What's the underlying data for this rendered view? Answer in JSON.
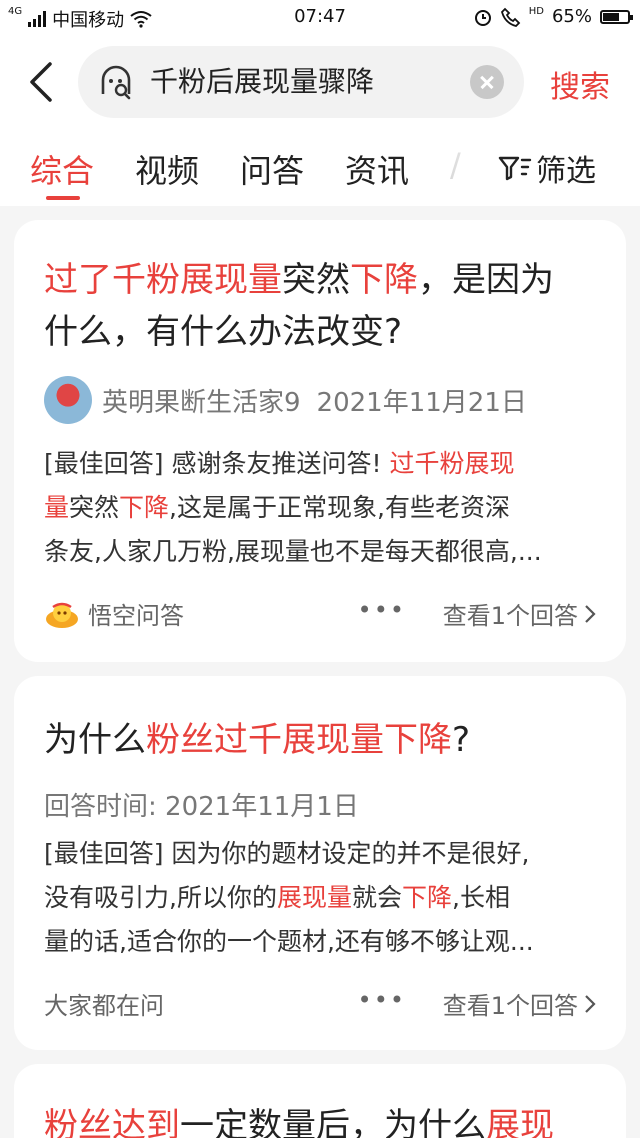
{
  "status_bar": {
    "network": "4G",
    "carrier": "中国移动",
    "time": "07:47",
    "hd_label": "HD",
    "battery": "65%",
    "battery_level": 0.65
  },
  "search": {
    "query": "千粉后展现量骤降",
    "submit_label": "搜索"
  },
  "tabs": [
    "综合",
    "视频",
    "问答",
    "资讯"
  ],
  "tab_partial": "/",
  "active_tab": 0,
  "filter_label": "筛选",
  "colors": {
    "accent": "#e8413c"
  },
  "results": [
    {
      "title_line1": [
        {
          "t": "过了千粉展现量",
          "hl": true
        },
        {
          "t": "突然",
          "hl": false
        },
        {
          "t": "下降",
          "hl": true
        },
        {
          "t": "，是因为",
          "hl": false
        }
      ],
      "title_line2": "什么，有什么办法改变?",
      "author": "英明果断生活家9",
      "date": "2021年11月21日",
      "excerpt_line1": [
        {
          "t": "[最佳回答] 感谢条友推送问答! ",
          "hl": false
        },
        {
          "t": "过千粉展现",
          "hl": true
        }
      ],
      "excerpt_line2": [
        {
          "t": "量",
          "hl": true
        },
        {
          "t": "突然",
          "hl": false
        },
        {
          "t": "下降",
          "hl": true
        },
        {
          "t": ",这是属于正常现象,有些老资深",
          "hl": false
        }
      ],
      "excerpt_line3": "条友,人家几万粉,展现量也不是每天都很高,...",
      "source": "悟空问答",
      "more": "•••",
      "view_answers": "查看1个回答"
    },
    {
      "title_line1": [
        {
          "t": "为什么",
          "hl": false
        },
        {
          "t": "粉丝过千展现量下降",
          "hl": true
        },
        {
          "t": "?",
          "hl": false
        }
      ],
      "meta": "回答时间: 2021年11月1日",
      "excerpt_line1": [
        {
          "t": "[最佳回答] 因为你的题材设定的并不是很好,",
          "hl": false
        }
      ],
      "excerpt_line2": [
        {
          "t": "没有吸引力,所以你的",
          "hl": false
        },
        {
          "t": "展现量",
          "hl": true
        },
        {
          "t": "就会",
          "hl": false
        },
        {
          "t": "下降",
          "hl": true
        },
        {
          "t": ",长相",
          "hl": false
        }
      ],
      "excerpt_line3": "量的话,适合你的一个题材,还有够不够让观...",
      "source": "大家都在问",
      "more": "•••",
      "view_answers": "查看1个回答"
    },
    {
      "title_line1": [
        {
          "t": "粉丝达到",
          "hl": true
        },
        {
          "t": "一定数量后，为什么",
          "hl": false
        },
        {
          "t": "展现",
          "hl": true
        }
      ]
    }
  ]
}
